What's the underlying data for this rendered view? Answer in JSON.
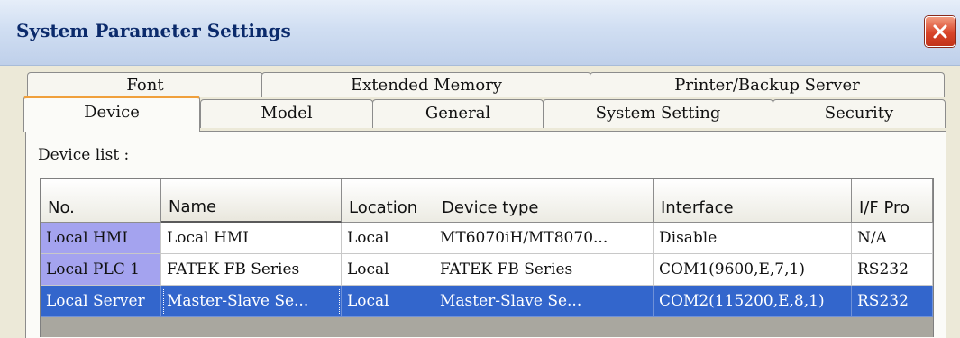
{
  "window": {
    "title": "System Parameter Settings"
  },
  "tabs_row1": [
    {
      "label": "Font"
    },
    {
      "label": "Extended Memory"
    },
    {
      "label": "Printer/Backup Server"
    }
  ],
  "tabs_row2": [
    {
      "label": "Device",
      "active": true
    },
    {
      "label": "Model"
    },
    {
      "label": "General"
    },
    {
      "label": "System Setting"
    },
    {
      "label": "Security"
    }
  ],
  "device_list": {
    "label": "Device list :",
    "columns": [
      "No.",
      "Name",
      "Location",
      "Device type",
      "Interface",
      "I/F Pro"
    ],
    "rows": [
      [
        "Local HMI",
        "Local HMI",
        "Local",
        "MT6070iH/MT8070...",
        "Disable",
        "N/A"
      ],
      [
        "Local PLC 1",
        "FATEK FB Series",
        "Local",
        "FATEK FB Series",
        "COM1(9600,E,7,1)",
        "RS232"
      ],
      [
        "Local Server",
        "Master-Slave Se...",
        "Local",
        "Master-Slave Se...",
        "COM2(115200,E,8,1)",
        "RS232"
      ]
    ],
    "selected_row": 2
  },
  "colors": {
    "selection": "#3366cc",
    "first_column_highlight": "#a4a3ef",
    "close_button": "#d8452a",
    "active_tab_accent": "#f0a03c"
  }
}
